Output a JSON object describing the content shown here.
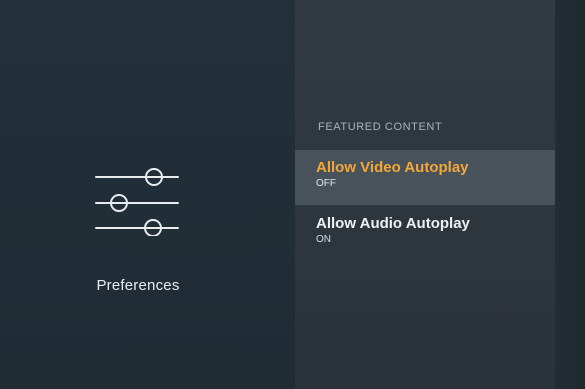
{
  "left_panel": {
    "icon": "sliders-icon",
    "label": "Preferences"
  },
  "right_panel": {
    "section_title": "FEATURED CONTENT",
    "items": [
      {
        "title": "Allow Video Autoplay",
        "value": "OFF",
        "selected": true
      },
      {
        "title": "Allow Audio Autoplay",
        "value": "ON",
        "selected": false
      }
    ]
  },
  "colors": {
    "background_dark": "#1f2c34",
    "panel_background": "#2a3339",
    "selected_row": "#48525a",
    "accent": "#f3a73a",
    "text_primary": "#eef1f3",
    "text_secondary": "#a9b2b8"
  }
}
